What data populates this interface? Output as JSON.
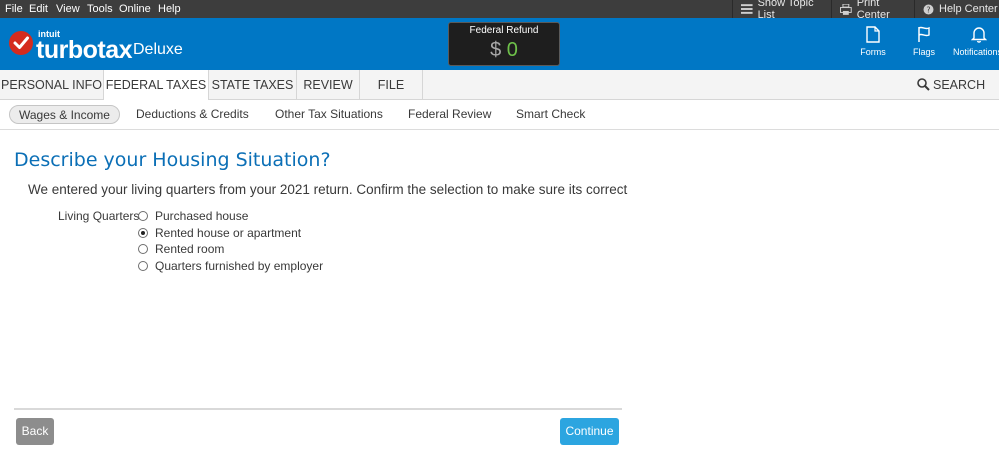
{
  "menubar": {
    "items": [
      "File",
      "Edit",
      "View",
      "Tools",
      "Online",
      "Help"
    ],
    "show_topic_list": "Show Topic List",
    "print_center": "Print Center",
    "help_center": "Help Center"
  },
  "header": {
    "logo_intuit": "intuit",
    "logo_name": "turbotax",
    "logo_edition": "Deluxe",
    "refund_label": "Federal Refund",
    "refund_currency": "$",
    "refund_value": "0",
    "icons": {
      "forms": "Forms",
      "flags": "Flags",
      "notifications": "Notifications"
    }
  },
  "tabs": [
    "PERSONAL INFO",
    "FEDERAL TAXES",
    "STATE TAXES",
    "REVIEW",
    "FILE"
  ],
  "active_tab": "FEDERAL TAXES",
  "search_label": "SEARCH",
  "subtabs": [
    "Wages & Income",
    "Deductions & Credits",
    "Other Tax Situations",
    "Federal Review",
    "Smart Check"
  ],
  "active_subtab": "Wages & Income",
  "main": {
    "title": "Describe your Housing Situation?",
    "instruction": "We entered your living quarters from your 2021 return. Confirm the selection to make sure its correct",
    "field_label": "Living Quarters",
    "options": [
      "Purchased house",
      "Rented house or apartment",
      "Rented room",
      "Quarters furnished by employer"
    ],
    "selected_option": "Rented house or apartment"
  },
  "footer": {
    "back": "Back",
    "continue": "Continue"
  },
  "colors": {
    "header_blue": "#0077c5",
    "title_blue": "#0b6fb6",
    "continue_blue": "#2ca5e0",
    "back_gray": "#8d8d8d",
    "refund_green": "#6ec14a",
    "logo_red": "#d52b1e"
  }
}
